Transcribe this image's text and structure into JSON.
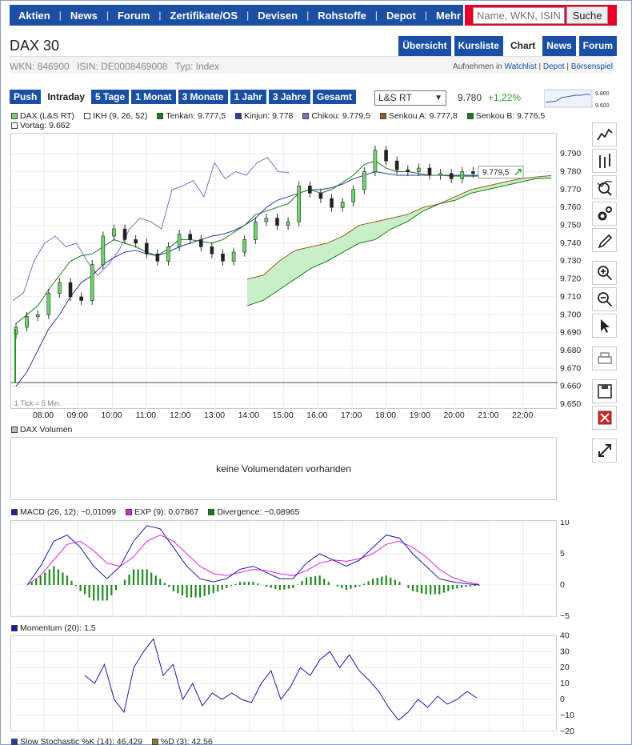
{
  "nav": {
    "items": [
      "Aktien",
      "News",
      "Forum",
      "Zertifikate/OS",
      "Devisen",
      "Rohstoffe",
      "Depot",
      "Mehr"
    ],
    "search_placeholder": "Name, WKN, ISIN",
    "search_button": "Suche"
  },
  "instrument": {
    "title": "DAX 30",
    "wkn": "WKN: 846900",
    "isin": "ISIN: DE0008469008",
    "type": "Typ: Index"
  },
  "tabs": [
    "Übersicht",
    "Kursliste",
    "Chart",
    "News",
    "Forum"
  ],
  "active_tab": "Chart",
  "links": {
    "prefix": "Aufnehmen in",
    "watchlist": "Watchlist",
    "depot": "Depot",
    "spiel": "Börsenspiel"
  },
  "ranges": [
    "Push",
    "Intraday",
    "5 Tage",
    "1 Monat",
    "3 Monate",
    "1 Jahr",
    "3 Jahre",
    "Gesamt"
  ],
  "active_range": "Intraday",
  "exchange": "L&S RT",
  "last_price": "9.780",
  "change_pct": "+1,22%",
  "mini_chart": {
    "top": "9.800",
    "bottom": "9.600"
  },
  "legend_main": [
    {
      "label": "DAX (L&S RT)",
      "color": "#6cd96c"
    },
    {
      "label": "IKH (9, 26, 52)",
      "color": "#ffffff"
    },
    {
      "label": "Tenkan: 9.777,5",
      "color": "#1f7a1f"
    },
    {
      "label": "Kinjun: 9.778",
      "color": "#2a3aa8"
    },
    {
      "label": "Chikou: 9.779,5",
      "color": "#8a6cc8"
    },
    {
      "label": "Senkou A: 9.777,8",
      "color": "#9a5a2a"
    },
    {
      "label": "Senkou B: 9.776,5",
      "color": "#1f7a1f"
    },
    {
      "label": "Vortag: 9.662",
      "color": "#ffffff"
    }
  ],
  "tick_note": "1 Tick = 5 Min.",
  "price_flag": "9.779,5",
  "volume": {
    "legend": "DAX Volumen",
    "empty_text": "keine Volumendaten vorhanden",
    "color": "#bbbbbb"
  },
  "macd_legend": [
    {
      "label": "MACD (26, 12): −0,01099",
      "color": "#1a1aa8"
    },
    {
      "label": "EXP (9): 0,07867",
      "color": "#e020e0"
    },
    {
      "label": "Divergence: −0,08965",
      "color": "#1f7a1f"
    }
  ],
  "momentum_legend": [
    {
      "label": "Momentum (20): 1,5",
      "color": "#1a1aa8"
    }
  ],
  "stoch_legend": [
    {
      "label": "Slow Stochastic %K (14): 46,429",
      "color": "#2a3aa8"
    },
    {
      "label": "%D (3): 42,56",
      "color": "#8a7a3a"
    }
  ],
  "tools": [
    "line-tool-icon",
    "bar-tool-icon",
    "indicator-tool-icon",
    "settings-icon",
    "draw-tool-icon",
    "zoom-in-icon",
    "zoom-out-icon",
    "pointer-icon",
    "print-icon",
    "save-icon",
    "delete-icon",
    "expand-icon"
  ],
  "chart_data": [
    {
      "type": "line",
      "name": "DAX (L&S RT)",
      "x_labels": [
        "08:00",
        "09:00",
        "10:00",
        "11:00",
        "12:00",
        "13:00",
        "14:00",
        "15:00",
        "16:00",
        "17:00",
        "18:00",
        "19:00",
        "20:00",
        "21:00",
        "22:00"
      ],
      "y_ticks": [
        "9.790",
        "9.780",
        "9.770",
        "9.760",
        "9.750",
        "9.740",
        "9.730",
        "9.720",
        "9.710",
        "9.700",
        "9.690",
        "9.680",
        "9.670",
        "9.660",
        "9.650"
      ],
      "ylim": [
        9650,
        9795
      ],
      "close": [
        9693,
        9699,
        9700,
        9712,
        9718,
        9710,
        9708,
        9728,
        9744,
        9748,
        9742,
        9740,
        9734,
        9730,
        9738,
        9745,
        9742,
        9738,
        9734,
        9730,
        9735,
        9742,
        9752,
        9754,
        9750,
        9752,
        9772,
        9768,
        9765,
        9760,
        9763,
        9770,
        9780,
        9792,
        9786,
        9781,
        9780,
        9782,
        9778,
        9779,
        9776,
        9780,
        9779,
        9779.5
      ],
      "tenkan": [
        9695,
        9700,
        9705,
        9714,
        9722,
        9730,
        9733,
        9734,
        9738,
        9742,
        9740,
        9738,
        9735,
        9733,
        9737,
        9742,
        9742,
        9741,
        9740,
        9742,
        9746,
        9750,
        9756,
        9758,
        9760,
        9762,
        9768,
        9770,
        9768,
        9770,
        9774,
        9778,
        9784,
        9786,
        9782,
        9780,
        9780,
        9779,
        9778,
        9778,
        9777.5,
        9777.5,
        9777.5,
        9777.5
      ],
      "kinjun": [
        9660,
        9668,
        9680,
        9692,
        9700,
        9710,
        9718,
        9722,
        9728,
        9732,
        9735,
        9736,
        9734,
        9733,
        9735,
        9738,
        9740,
        9742,
        9744,
        9745,
        9747,
        9750,
        9754,
        9760,
        9764,
        9766,
        9768,
        9770,
        9770,
        9771,
        9773,
        9776,
        9778,
        9780,
        9779,
        9778,
        9778,
        9778,
        9778,
        9778,
        9778,
        9778,
        9778,
        9778
      ],
      "chikou": [
        9708,
        9712,
        9730,
        9740,
        9744,
        9738,
        9740,
        9730,
        9722,
        9728,
        9736,
        9748,
        9754,
        9752,
        9748,
        9770,
        9772,
        9775,
        9766,
        9785,
        9776,
        9780,
        9778,
        9785,
        9788,
        9780,
        9779.5
      ],
      "senkou_a": [
        9720,
        9722,
        9730,
        9736,
        9738,
        9740,
        9744,
        9750,
        9752,
        9754,
        9756,
        9760,
        9762,
        9766,
        9770,
        9772,
        9774,
        9776,
        9777,
        9777.8
      ],
      "senkou_b": [
        9705,
        9708,
        9714,
        9720,
        9726,
        9730,
        9735,
        9740,
        9742,
        9748,
        9752,
        9758,
        9762,
        9764,
        9768,
        9770,
        9772,
        9774,
        9776,
        9776.5
      ],
      "vortag": 9662
    },
    {
      "type": "line",
      "name": "MACD",
      "y_ticks": [
        "10",
        "5",
        "0",
        "−5"
      ],
      "ylim": [
        -5,
        10
      ],
      "macd": [
        0,
        3,
        7,
        8,
        6,
        3,
        1,
        3,
        7,
        9.5,
        9,
        6,
        3,
        1,
        0.5,
        1,
        2.5,
        3,
        2,
        1,
        1,
        3.5,
        5,
        4,
        3,
        4,
        6,
        8,
        7.5,
        5,
        3,
        1,
        0.5,
        0.2,
        0
      ],
      "exp": [
        0,
        1.5,
        4,
        6.5,
        7,
        5.5,
        3.5,
        3,
        4.5,
        7,
        8,
        7,
        5,
        3,
        1.8,
        1.5,
        2,
        2.5,
        2.3,
        1.8,
        1.5,
        2.3,
        3.5,
        4,
        3.8,
        4.2,
        5,
        6.5,
        7,
        6,
        4.5,
        2.5,
        1.2,
        0.5,
        0.1
      ],
      "divergence": [
        0,
        1.5,
        3,
        1.5,
        -1,
        -2.5,
        -2.5,
        0,
        2.5,
        2.5,
        1,
        -1,
        -2,
        -2,
        -1.3,
        -0.5,
        0.5,
        0.5,
        -0.3,
        -0.8,
        -0.5,
        1.2,
        1.5,
        0,
        -0.8,
        -0.2,
        1,
        1.5,
        0.5,
        -1,
        -1.5,
        -1.5,
        -0.7,
        -0.3,
        -0.1
      ]
    },
    {
      "type": "line",
      "name": "Momentum",
      "y_ticks": [
        "40",
        "30",
        "20",
        "10",
        "0",
        "−10",
        "−20"
      ],
      "ylim": [
        -20,
        40
      ],
      "momentum": [
        15,
        10,
        22,
        0,
        -8,
        20,
        30,
        38,
        15,
        22,
        0,
        10,
        -4,
        4,
        0,
        4,
        0,
        -2,
        10,
        18,
        0,
        8,
        20,
        15,
        25,
        30,
        20,
        28,
        18,
        12,
        5,
        -5,
        -13,
        -8,
        0,
        -5,
        2,
        -3,
        0,
        5,
        1
      ],
      "zero_line": 0
    }
  ]
}
